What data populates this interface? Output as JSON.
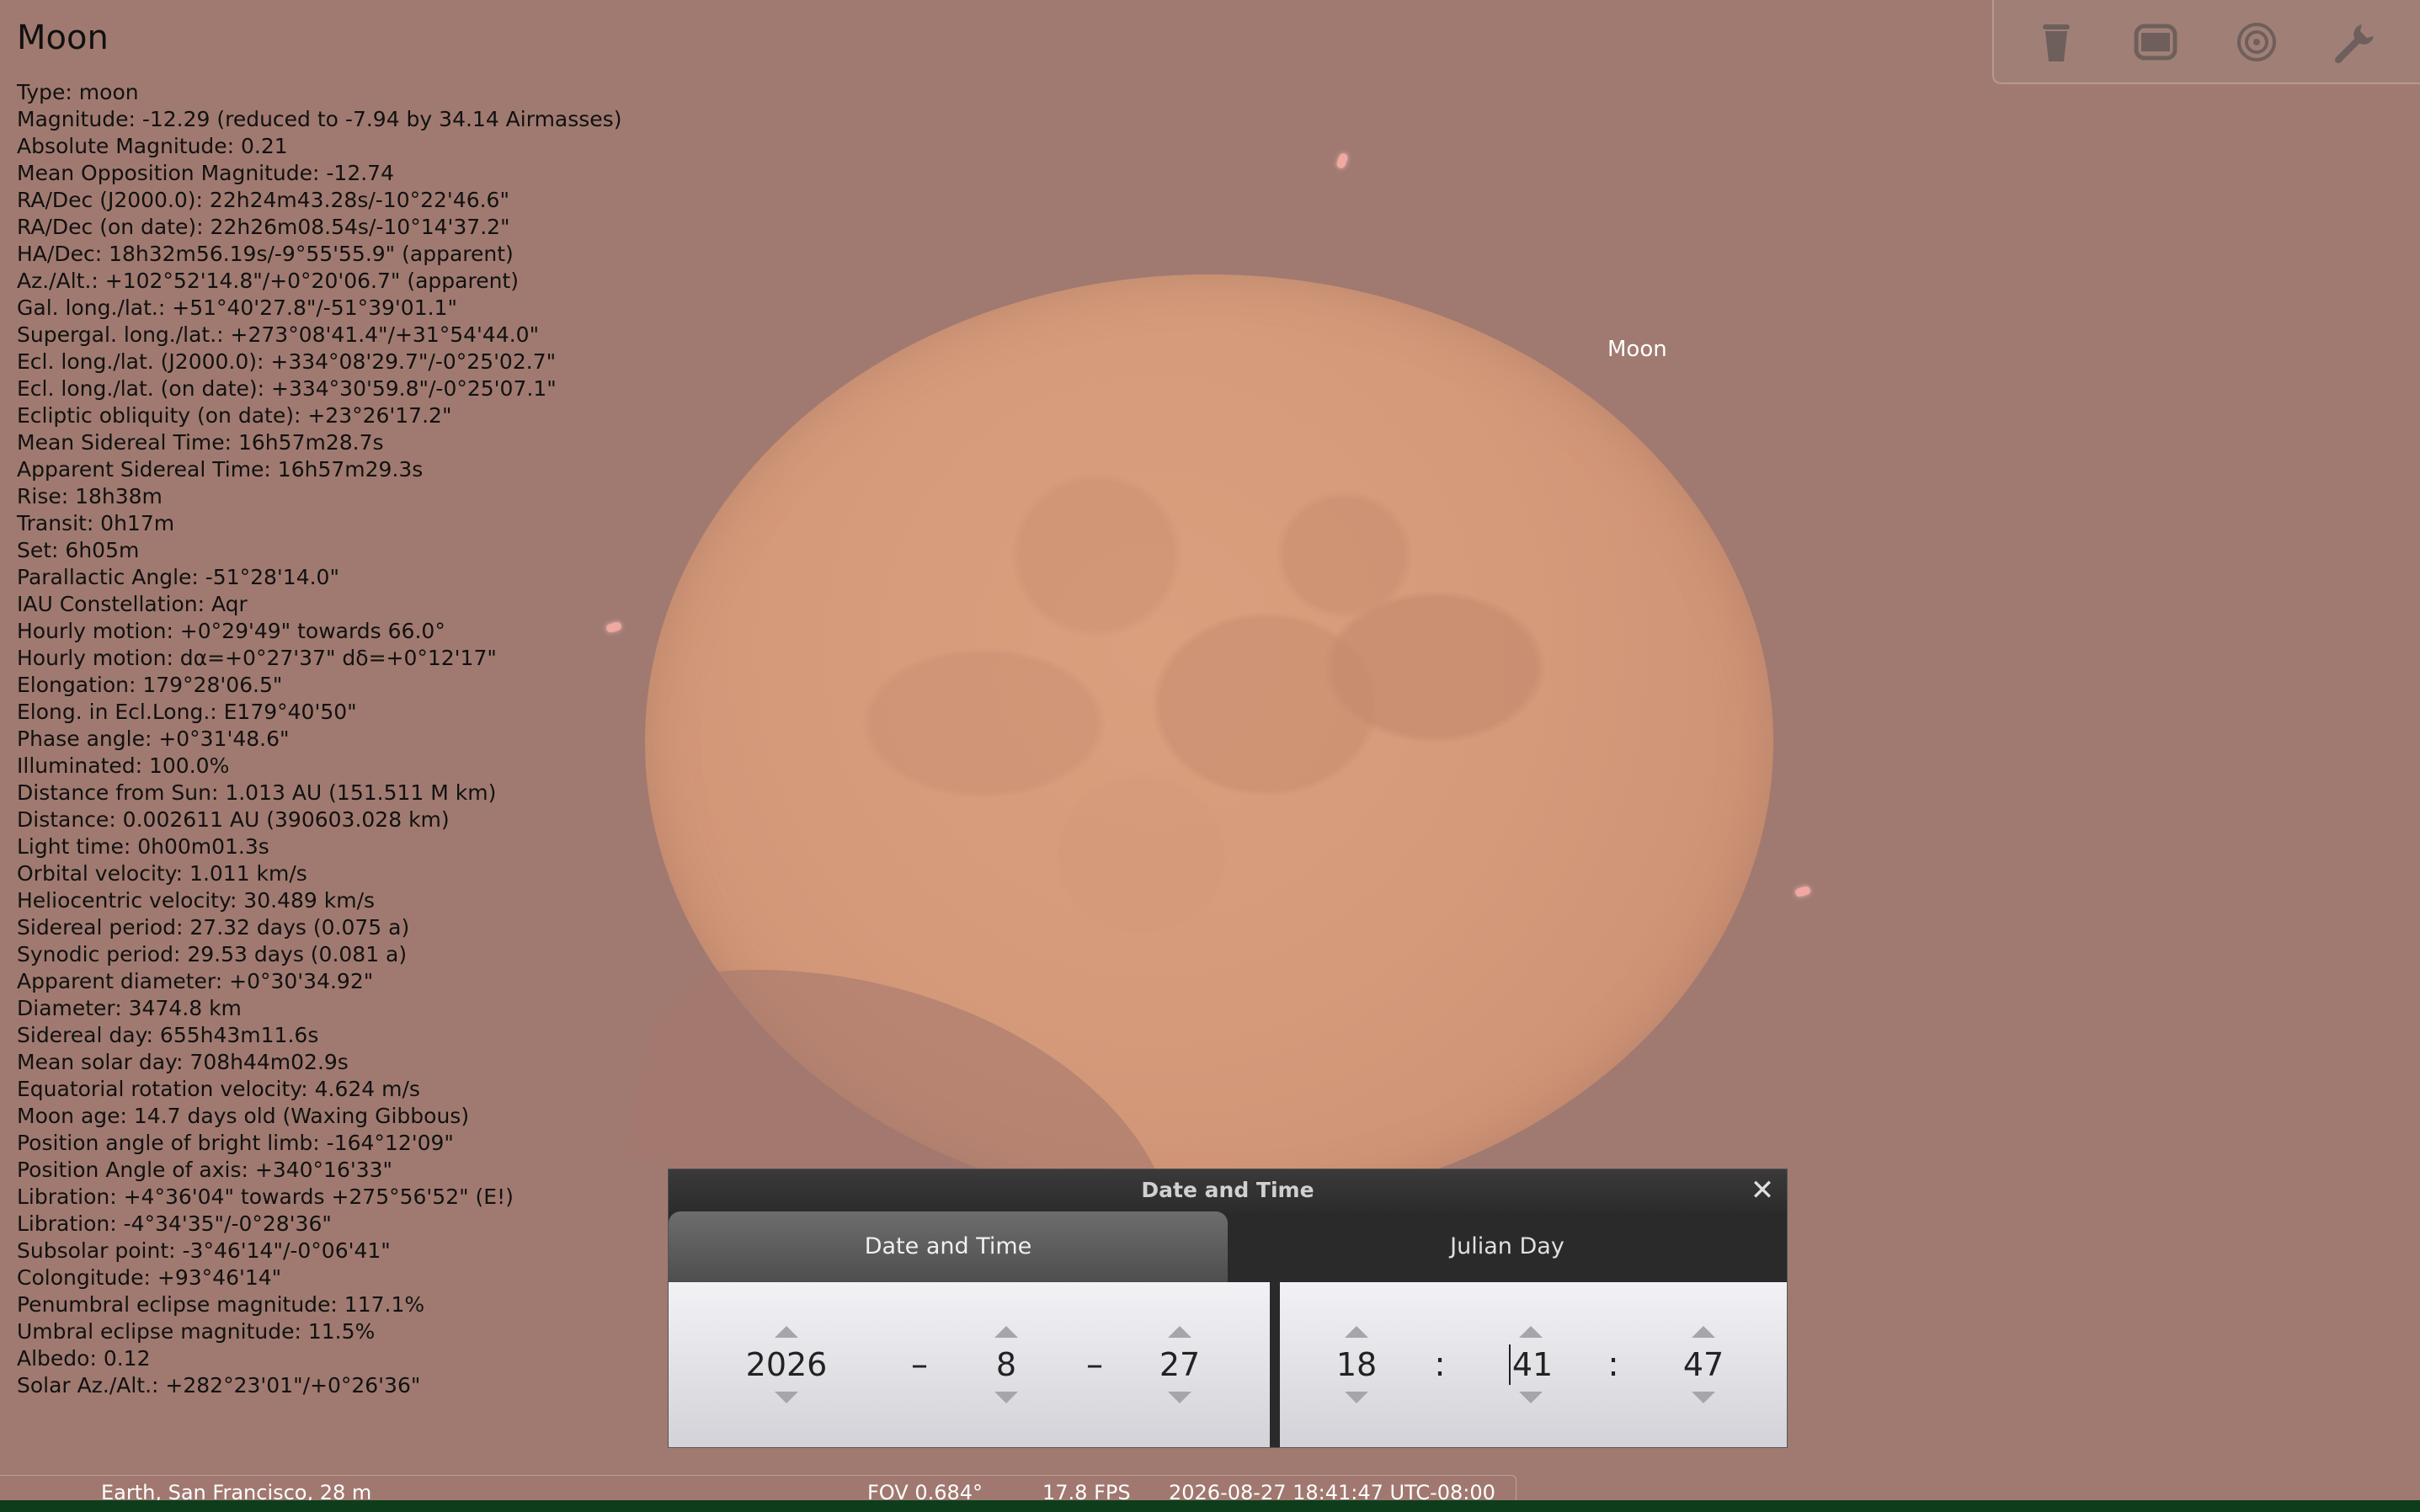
{
  "object": {
    "name": "Moon",
    "sky_label": "Moon",
    "details": [
      "Type: moon",
      "Magnitude: -12.29 (reduced to -7.94 by 34.14 Airmasses)",
      "Absolute Magnitude: 0.21",
      "Mean Opposition Magnitude: -12.74",
      "RA/Dec (J2000.0): 22h24m43.28s/-10°22'46.6\"",
      "RA/Dec (on date): 22h26m08.54s/-10°14'37.2\"",
      "HA/Dec: 18h32m56.19s/-9°55'55.9\" (apparent)",
      "Az./Alt.: +102°52'14.8\"/+0°20'06.7\" (apparent)",
      "Gal. long./lat.: +51°40'27.8\"/-51°39'01.1\"",
      "Supergal. long./lat.: +273°08'41.4\"/+31°54'44.0\"",
      "Ecl. long./lat. (J2000.0): +334°08'29.7\"/-0°25'02.7\"",
      "Ecl. long./lat. (on date): +334°30'59.8\"/-0°25'07.1\"",
      "Ecliptic obliquity (on date): +23°26'17.2\"",
      "Mean Sidereal Time: 16h57m28.7s",
      "Apparent Sidereal Time: 16h57m29.3s",
      "Rise: 18h38m",
      "Transit: 0h17m",
      "Set: 6h05m",
      "Parallactic Angle: -51°28'14.0\"",
      "IAU Constellation: Aqr",
      "Hourly motion: +0°29'49\" towards 66.0°",
      "Hourly motion: dα=+0°27'37\" dδ=+0°12'17\"",
      "Elongation: 179°28'06.5\"",
      "Elong. in Ecl.Long.: E179°40'50\"",
      "Phase angle: +0°31'48.6\"",
      "Illuminated: 100.0%",
      "Distance from Sun: 1.013 AU (151.511 M km)",
      "Distance: 0.002611 AU (390603.028 km)",
      "Light time: 0h00m01.3s",
      "Orbital velocity: 1.011 km/s",
      "Heliocentric velocity: 30.489 km/s",
      "Sidereal period: 27.32 days (0.075 a)",
      "Synodic period: 29.53 days (0.081 a)",
      "Apparent diameter: +0°30'34.92\"",
      "Diameter: 3474.8 km",
      "Sidereal day: 655h43m11.6s",
      "Mean solar day: 708h44m02.9s",
      "Equatorial rotation velocity: 4.624 m/s",
      "Moon age: 14.7 days old (Waxing Gibbous)",
      "Position angle of bright limb: -164°12'09\"",
      "Position Angle of axis: +340°16'33\"",
      "Libration: +4°36'04\" towards +275°56'52\" (E!)",
      "Libration: -4°34'35\"/-0°28'36\"",
      "Subsolar point: -3°46'14\"/-0°06'41\"",
      "Colongitude: +93°46'14\"",
      "Penumbral eclipse magnitude: 117.1%",
      "Umbral eclipse magnitude: 11.5%",
      "Albedo: 0.12",
      "Solar Az./Alt.: +282°23'01\"/+0°26'36\""
    ]
  },
  "toolbar": {
    "buttons": [
      "trash-icon",
      "screen-icon",
      "target-icon",
      "wrench-icon"
    ]
  },
  "dialog": {
    "title": "Date and Time",
    "tabs": [
      "Date and Time",
      "Julian Day"
    ],
    "date": {
      "year": "2026",
      "month": "8",
      "day": "27",
      "sep1": "–",
      "sep2": "–"
    },
    "time": {
      "hour": "18",
      "minute": "41",
      "second": "47",
      "sep1": ":",
      "sep2": ":"
    }
  },
  "status": {
    "location": "Earth, San Francisco, 28 m",
    "fov": "FOV 0.684°",
    "fps": "17.8 FPS",
    "datetime": "2026-08-27 18:41:47 UTC-08:00"
  },
  "colors": {
    "sky": "#a07a70",
    "moon": "#d49a7a",
    "dialog_bg": "#2a2a2a",
    "ground": "#0e3d1c"
  }
}
